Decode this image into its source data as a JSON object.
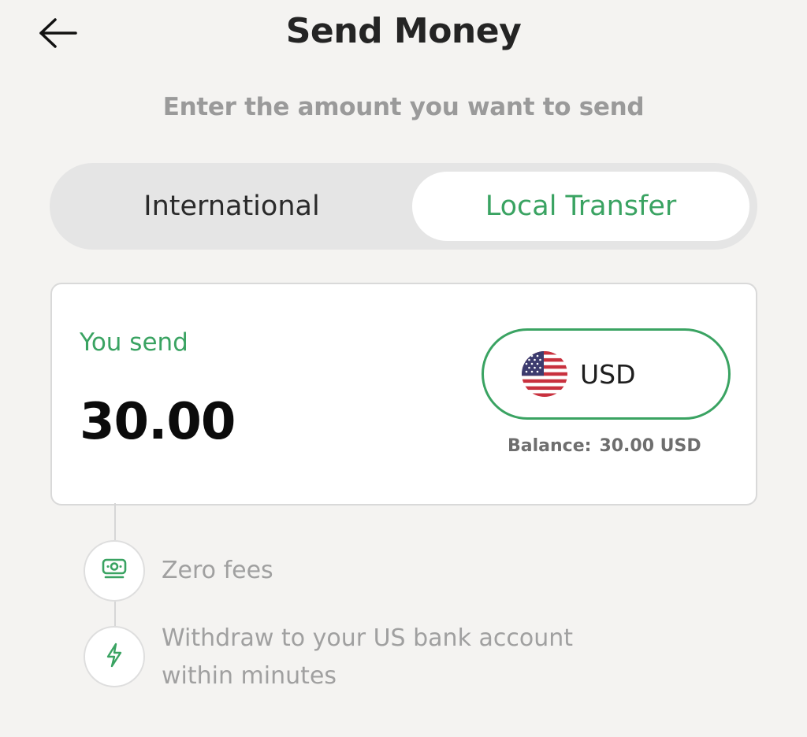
{
  "header": {
    "back_icon": "arrow-left-icon",
    "title": "Send Money"
  },
  "subtitle": "Enter the amount you want to send",
  "tabs": [
    {
      "label": "International",
      "selected": false
    },
    {
      "label": "Local Transfer",
      "selected": true
    }
  ],
  "send_card": {
    "label": "You send",
    "amount": "30.00",
    "currency": {
      "code": "USD",
      "flag_icon": "us-flag-icon"
    },
    "balance_label": "Balance:",
    "balance_value": "30.00 USD"
  },
  "features": [
    {
      "icon": "money-icon",
      "text": "Zero fees"
    },
    {
      "icon": "lightning-icon",
      "text_line1": "Withdraw to your US bank account",
      "text_line2": "within minutes"
    }
  ],
  "colors": {
    "accent": "#3aa362",
    "background": "#f4f3f1",
    "segment_bg": "#e5e5e5",
    "card_bg": "#ffffff",
    "muted_text": "#a0a0a0"
  }
}
